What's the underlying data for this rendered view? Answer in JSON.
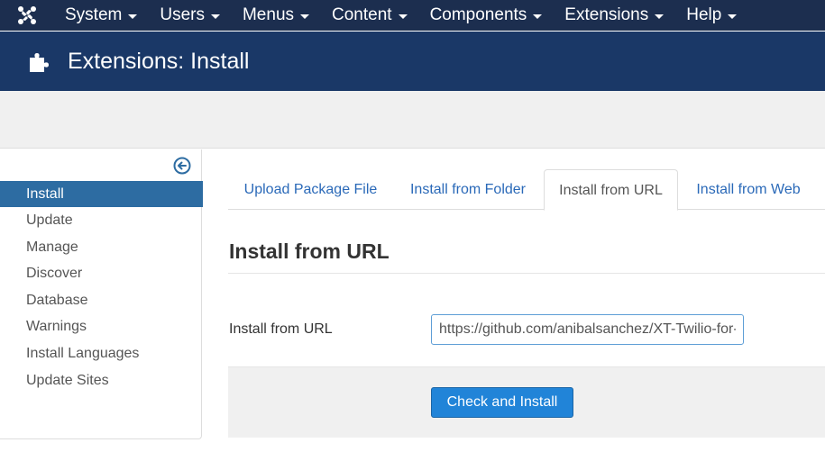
{
  "menubar": {
    "items": [
      {
        "label": "System"
      },
      {
        "label": "Users"
      },
      {
        "label": "Menus"
      },
      {
        "label": "Content"
      },
      {
        "label": "Components"
      },
      {
        "label": "Extensions"
      },
      {
        "label": "Help"
      }
    ],
    "logo_icon": "joomla-logo-icon",
    "dropdown_icon": "caret-down-icon"
  },
  "header": {
    "title": "Extensions: Install",
    "icon": "puzzle-piece-icon"
  },
  "sidebar": {
    "toggle_icon": "arrow-circle-left-icon",
    "items": [
      {
        "label": "Install"
      },
      {
        "label": "Update"
      },
      {
        "label": "Manage"
      },
      {
        "label": "Discover"
      },
      {
        "label": "Database"
      },
      {
        "label": "Warnings"
      },
      {
        "label": "Install Languages"
      },
      {
        "label": "Update Sites"
      }
    ],
    "active_item": "Install"
  },
  "tabs": [
    {
      "label": "Upload Package File"
    },
    {
      "label": "Install from Folder"
    },
    {
      "label": "Install from URL"
    },
    {
      "label": "Install from Web"
    }
  ],
  "active_tab": "Install from URL",
  "content": {
    "section_title": "Install from URL",
    "field_label": "Install from URL",
    "url_value": "https://github.com/anibalsanchez/XT-Twilio-for-Joomla/",
    "submit_label": "Check and Install"
  },
  "colors": {
    "menubar": "#1c2e4f",
    "header": "#1a3867",
    "accent": "#2184d8",
    "link": "#2a69b8",
    "active_sidebar": "#2d6ca2"
  }
}
